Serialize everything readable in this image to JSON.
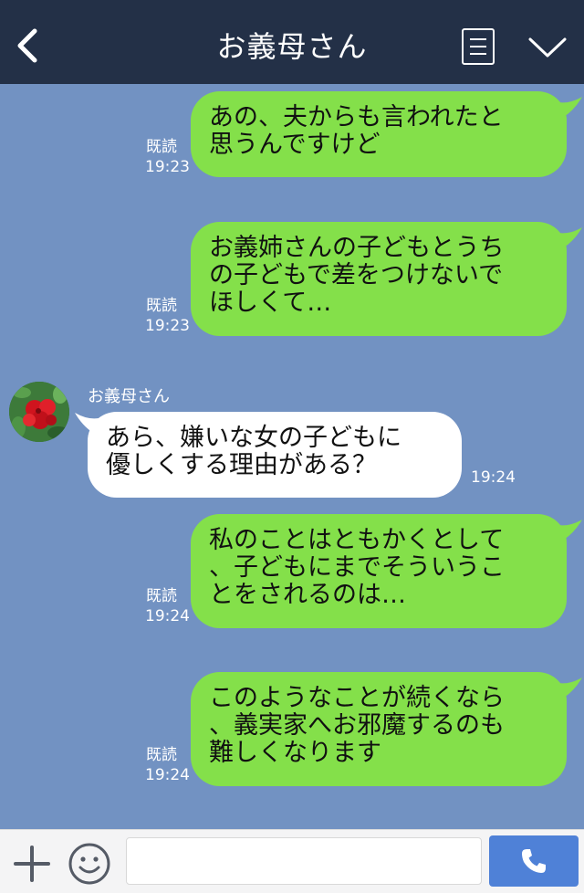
{
  "header": {
    "title": "お義母さん",
    "back_icon": "chevron-left-icon",
    "menu_icon": "notes-icon",
    "dropdown_icon": "chevron-down-icon"
  },
  "messages": [
    {
      "direction": "out",
      "text": "あの、夫からも言われたと\n思うんですけど",
      "read": "既読",
      "time": "19:23"
    },
    {
      "direction": "out",
      "text": "お義姉さんの子どもとうち\nの子どもで差をつけないで\nほしくて…",
      "read": "既読",
      "time": "19:23"
    },
    {
      "direction": "in",
      "sender": "お義母さん",
      "text": "あら、嫌いな女の子どもに\n優しくする理由がある？",
      "time": "19:24"
    },
    {
      "direction": "out",
      "text": "私のことはともかくとして\n、子どもにまでそういうこ\nとをされるのは…",
      "read": "既読",
      "time": "19:24"
    },
    {
      "direction": "out",
      "text": "このようなことが続くなら\n、義実家へお邪魔するのも\n難しくなります",
      "read": "既読",
      "time": "19:24"
    }
  ],
  "footer": {
    "input_value": "",
    "input_placeholder": "",
    "plus_icon": "plus-icon",
    "emoji_icon": "smile-icon",
    "call_icon": "phone-icon"
  },
  "colors": {
    "header_bg": "#233047",
    "chat_bg": "#7292c2",
    "outgoing_bubble": "#84e04a",
    "incoming_bubble": "#ffffff",
    "call_button": "#4f81d7"
  }
}
